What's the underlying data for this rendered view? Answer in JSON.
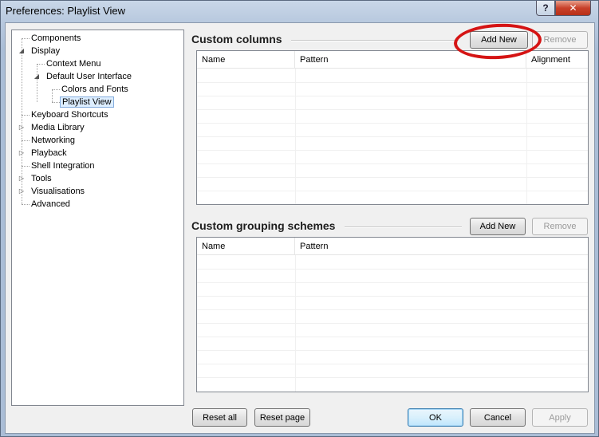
{
  "window": {
    "title": "Preferences: Playlist View",
    "help_label": "?",
    "close_label": "✕"
  },
  "tree": {
    "items": [
      {
        "label": "Components"
      },
      {
        "label": "Display"
      },
      {
        "label": "Context Menu"
      },
      {
        "label": "Default User Interface"
      },
      {
        "label": "Colors and Fonts"
      },
      {
        "label": "Playlist View",
        "selected": true
      },
      {
        "label": "Keyboard Shortcuts"
      },
      {
        "label": "Media Library"
      },
      {
        "label": "Networking"
      },
      {
        "label": "Playback"
      },
      {
        "label": "Shell Integration"
      },
      {
        "label": "Tools"
      },
      {
        "label": "Visualisations"
      },
      {
        "label": "Advanced"
      }
    ],
    "expand_glyph": "▷",
    "collapse_glyph": "◢"
  },
  "columns_section": {
    "title": "Custom columns",
    "add_label": "Add New",
    "remove_label": "Remove",
    "headers": [
      "Name",
      "Pattern",
      "Alignment"
    ]
  },
  "grouping_section": {
    "title": "Custom grouping schemes",
    "add_label": "Add New",
    "remove_label": "Remove",
    "headers": [
      "Name",
      "Pattern"
    ]
  },
  "footer": {
    "reset_all": "Reset all",
    "reset_page": "Reset page",
    "ok": "OK",
    "cancel": "Cancel",
    "apply": "Apply"
  },
  "colors": {
    "annotation": "#d51414",
    "selection": "#ddeeff"
  }
}
